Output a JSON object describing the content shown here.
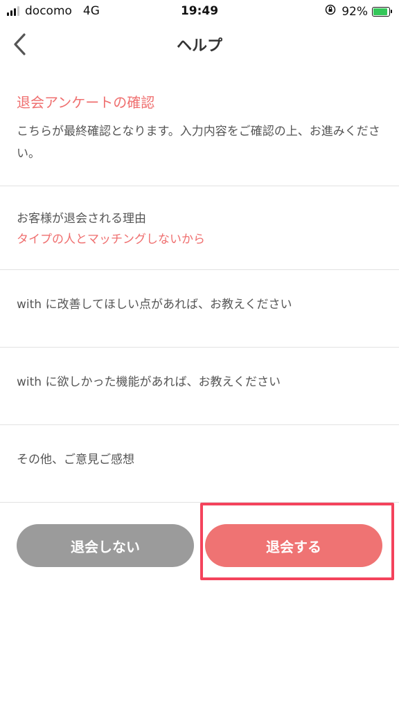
{
  "status_bar": {
    "carrier": "docomo",
    "network": "4G",
    "time": "19:49",
    "battery_percent": "92%",
    "battery_level": 0.92,
    "battery_color": "#34c759"
  },
  "nav": {
    "title": "ヘルプ",
    "back_icon": "chevron-left-icon"
  },
  "confirmation": {
    "heading": "退会アンケートの確認",
    "description": "こちらが最終確認となります。入力内容をご確認の上、お進みください。"
  },
  "reason": {
    "label": "お客様が退会される理由",
    "value": "タイプの人とマッチングしないから"
  },
  "questions": [
    {
      "label": "with に改善してほしい点があれば、お教えください"
    },
    {
      "label": "with に欲しかった機能があれば、お教えください"
    },
    {
      "label": "その他、ご意見ご感想"
    }
  ],
  "buttons": {
    "stay_label": "退会しない",
    "withdraw_label": "退会する"
  },
  "colors": {
    "accent": "#ef6f6f",
    "stay_button": "#9b9b9b",
    "withdraw_button": "#ef7373",
    "highlight": "#f4435c"
  }
}
